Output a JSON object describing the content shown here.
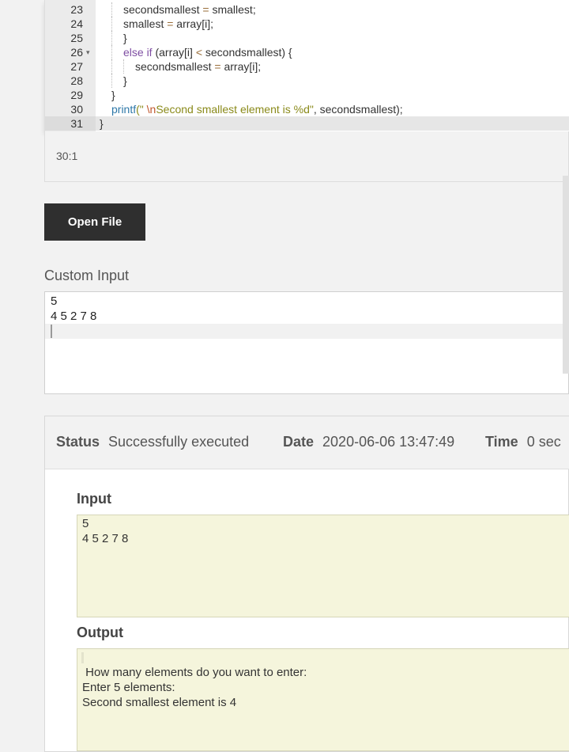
{
  "editor": {
    "lines": [
      {
        "num": "23",
        "indent": 2,
        "parts": [
          {
            "t": "secondsmallest ",
            "c": ""
          },
          {
            "t": "=",
            "c": "op"
          },
          {
            "t": " smallest;",
            "c": ""
          }
        ]
      },
      {
        "num": "24",
        "indent": 2,
        "parts": [
          {
            "t": "smallest ",
            "c": ""
          },
          {
            "t": "=",
            "c": "op"
          },
          {
            "t": " array[i];",
            "c": ""
          }
        ]
      },
      {
        "num": "25",
        "indent": 2,
        "parts": [
          {
            "t": "}",
            "c": ""
          }
        ]
      },
      {
        "num": "26",
        "indent": 2,
        "fold": true,
        "parts": [
          {
            "t": "else if",
            "c": "kw"
          },
          {
            "t": " (array[i] ",
            "c": ""
          },
          {
            "t": "<",
            "c": "op"
          },
          {
            "t": " secondsmallest) {",
            "c": ""
          }
        ]
      },
      {
        "num": "27",
        "indent": 3,
        "parts": [
          {
            "t": "secondsmallest ",
            "c": ""
          },
          {
            "t": "=",
            "c": "op"
          },
          {
            "t": " array[i];",
            "c": ""
          }
        ]
      },
      {
        "num": "28",
        "indent": 2,
        "parts": [
          {
            "t": "}",
            "c": ""
          }
        ]
      },
      {
        "num": "29",
        "indent": 1,
        "parts": [
          {
            "t": "}",
            "c": ""
          }
        ]
      },
      {
        "num": "30",
        "indent": 1,
        "parts": [
          {
            "t": "printf",
            "c": "fn"
          },
          {
            "t": "(\" ",
            "c": "str"
          },
          {
            "t": "\\n",
            "c": "esc"
          },
          {
            "t": "Second smallest element is %d\"",
            "c": "str"
          },
          {
            "t": ", secondsmallest);",
            "c": ""
          }
        ]
      },
      {
        "num": "31",
        "indent": 0,
        "active": true,
        "parts": [
          {
            "t": "}",
            "c": ""
          }
        ]
      }
    ],
    "cursor_position": "30:1"
  },
  "open_file_label": "Open File",
  "custom_input": {
    "label": "Custom Input",
    "lines": [
      "5",
      "4 5 2 7 8"
    ]
  },
  "status": {
    "status_key": "Status",
    "status_value": "Successfully executed",
    "date_key": "Date",
    "date_value": "2020-06-06 13:47:49",
    "time_key": "Time",
    "time_value": "0 sec"
  },
  "input_section": {
    "title": "Input",
    "lines": [
      "5",
      "4 5 2 7 8"
    ]
  },
  "output_section": {
    "title": "Output",
    "lines": [
      " How many elements do you want to enter:",
      "Enter 5 elements:",
      "Second smallest element is 4"
    ]
  }
}
